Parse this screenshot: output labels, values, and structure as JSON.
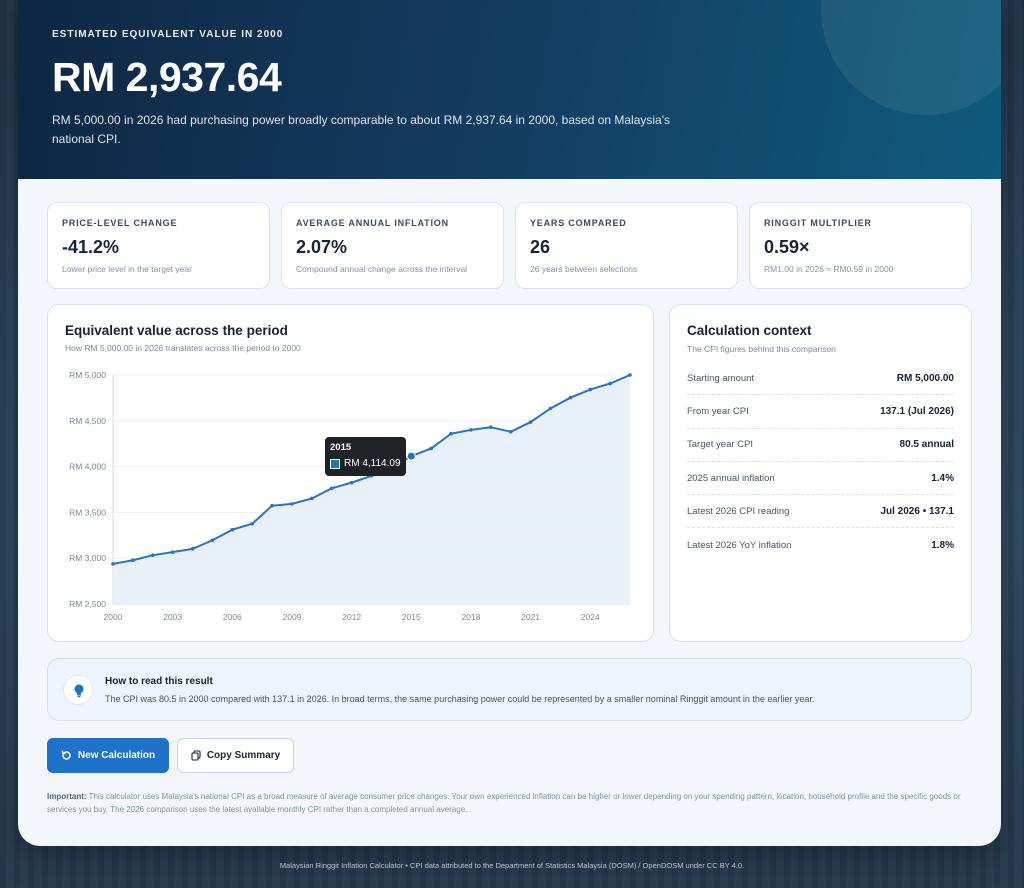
{
  "hero": {
    "eyebrow": "ESTIMATED EQUIVALENT VALUE IN 2000",
    "value": "RM 2,937.64",
    "description": "RM 5,000.00 in 2026 had purchasing power broadly comparable to about RM 2,937.64 in 2000, based on Malaysia's national CPI."
  },
  "stats": [
    {
      "label": "PRICE-LEVEL CHANGE",
      "value": "-41.2%",
      "sub": "Lower price level in the target year"
    },
    {
      "label": "AVERAGE ANNUAL INFLATION",
      "value": "2.07%",
      "sub": "Compound annual change across the interval"
    },
    {
      "label": "YEARS COMPARED",
      "value": "26",
      "sub": "26 years between selections"
    },
    {
      "label": "RINGGIT MULTIPLIER",
      "value": "0.59×",
      "sub": "RM1.00 in 2026 ≈ RM0.59 in 2000"
    }
  ],
  "chart": {
    "title": "Equivalent value across the period",
    "subtitle": "How RM 5,000.00 in 2026 translates across the period to 2000",
    "tooltip": {
      "year": "2015",
      "value": "RM 4,114.09"
    }
  },
  "chart_data": {
    "type": "area",
    "title": "Equivalent value across the period",
    "x": [
      2000,
      2001,
      2002,
      2003,
      2004,
      2005,
      2006,
      2007,
      2008,
      2009,
      2010,
      2011,
      2012,
      2013,
      2014,
      2015,
      2016,
      2017,
      2018,
      2019,
      2020,
      2021,
      2022,
      2023,
      2024,
      2025,
      2026
    ],
    "series": [
      {
        "values": [
          2937.64,
          2978,
          3033,
          3066,
          3102,
          3196,
          3311,
          3376,
          3573,
          3593,
          3652,
          3763,
          3825,
          3899,
          3985,
          4114.09,
          4198,
          4359,
          4401,
          4430,
          4380,
          4486,
          4635,
          4752,
          4841,
          4907,
          5000
        ],
        "color": "#2a74bf"
      }
    ],
    "xticks": [
      "2000",
      "2003",
      "2006",
      "2009",
      "2012",
      "2015",
      "2018",
      "2021",
      "2024"
    ],
    "yticks": [
      "RM 2,500",
      "RM 3,000",
      "RM 3,500",
      "RM 4,000",
      "RM 4,500",
      "RM 5,000"
    ],
    "ylim": [
      2500,
      5000
    ],
    "xlim": [
      2000,
      2026
    ],
    "grid": true,
    "highlight": {
      "x": 2015,
      "y": 4114.09
    }
  },
  "context": {
    "title": "Calculation context",
    "subtitle": "The CPI figures behind this comparison",
    "rows": [
      {
        "label": "Starting amount",
        "value": "RM 5,000.00"
      },
      {
        "label": "From year CPI",
        "value": "137.1 (Jul 2026)"
      },
      {
        "label": "Target year CPI",
        "value": "80.5 annual"
      },
      {
        "label": "2025 annual inflation",
        "value": "1.4%"
      },
      {
        "label": "Latest 2026 CPI reading",
        "value": "Jul 2026 • 137.1"
      },
      {
        "label": "Latest 2026 YoY inflation",
        "value": "1.8%"
      }
    ]
  },
  "info": {
    "icon": "lightbulb-icon",
    "title": "How to read this result",
    "text": "The CPI was 80.5 in 2000 compared with 137.1 in 2026. In broad terms, the same purchasing power could be represented by a smaller nominal Ringgit amount in the earlier year."
  },
  "buttons": {
    "new_calc": "New Calculation",
    "copy_summary": "Copy Summary"
  },
  "disclaimer": {
    "bold": "Important:",
    "text": " This calculator uses Malaysia's national CPI as a broad measure of average consumer price changes. Your own experienced inflation can be higher or lower depending on your spending pattern, location, household profile and the specific goods or services you buy. The 2026 comparison uses the latest available monthly CPI rather than a completed annual average."
  },
  "footer": "Malaysian Ringgit Inflation Calculator • CPI data attributed to the Department of Statistics Malaysia (DOSM) / OpenDOSM under CC BY 4.0.",
  "colors": {
    "accent": "#1f72c9",
    "hero_start": "#0e2742",
    "hero_end": "#0f5a7d",
    "line": "#2a74bf",
    "area": "#e6f0fa"
  }
}
